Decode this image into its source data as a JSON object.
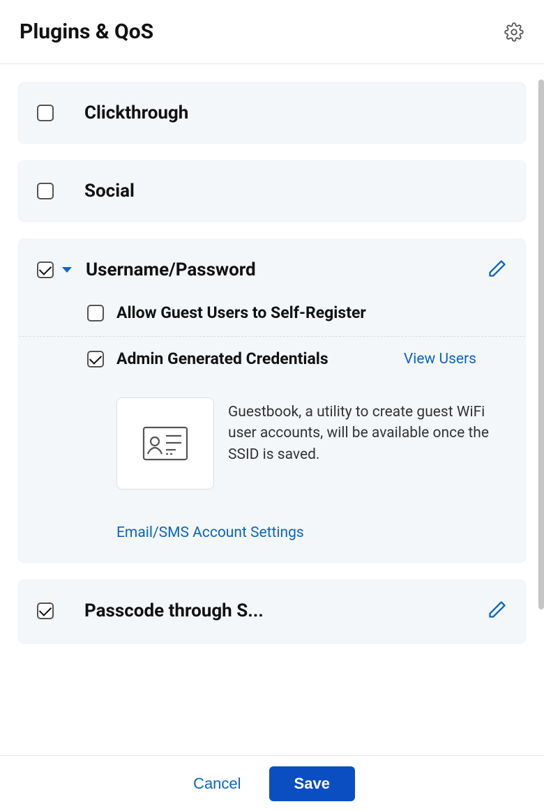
{
  "header": {
    "title": "Plugins & QoS"
  },
  "cards": {
    "clickthrough": {
      "label": "Clickthrough",
      "checked": false
    },
    "social": {
      "label": "Social",
      "checked": false
    },
    "usernamePassword": {
      "label": "Username/Password",
      "checked": true,
      "expanded": true,
      "sub": {
        "selfRegister": {
          "label": "Allow Guest Users to Self-Register",
          "checked": false
        },
        "adminGenerated": {
          "label": "Admin Generated Credentials",
          "checked": true,
          "viewUsersLabel": "View Users",
          "infoText": "Guestbook, a utility to create guest WiFi user accounts, will be available once the SSID is saved."
        },
        "emailSmsLink": "Email/SMS Account Settings"
      }
    },
    "passcodeSms": {
      "label": "Passcode through S...",
      "checked": true
    }
  },
  "footer": {
    "cancel": "Cancel",
    "save": "Save"
  }
}
